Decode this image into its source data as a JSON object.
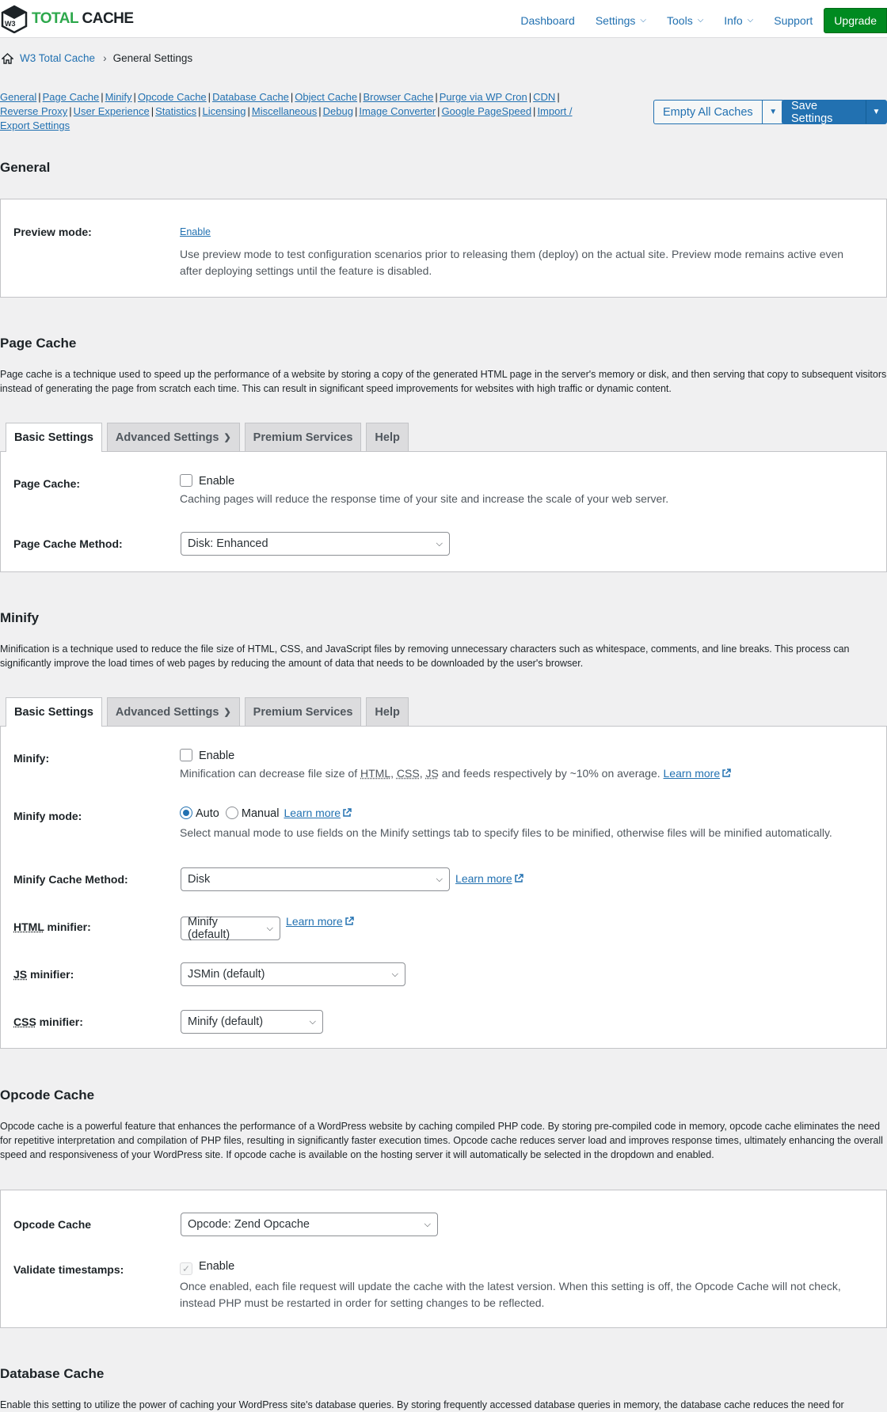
{
  "brand": {
    "logo_badge": "W3",
    "logo_part1": "TOTAL",
    "logo_part2": "CACHE"
  },
  "topnav": [
    {
      "label": "Dashboard",
      "dropdown": false
    },
    {
      "label": "Settings",
      "dropdown": true
    },
    {
      "label": "Tools",
      "dropdown": true
    },
    {
      "label": "Info",
      "dropdown": true
    },
    {
      "label": "Support",
      "dropdown": false
    }
  ],
  "upgrade_label": "Upgrade",
  "breadcrumb": {
    "root": "W3 Total Cache",
    "current": "General Settings"
  },
  "section_links": [
    "General",
    "Page Cache",
    "Minify",
    "Opcode Cache",
    "Database Cache",
    "Object Cache",
    "Browser Cache",
    "Purge via WP Cron",
    "CDN",
    "Reverse Proxy",
    "User Experience",
    "Statistics",
    "Licensing",
    "Miscellaneous",
    "Debug",
    "Image Converter",
    "Google PageSpeed",
    "Import / Export Settings"
  ],
  "actions": {
    "empty_caches": "Empty All Caches",
    "save_settings": "Save Settings"
  },
  "general": {
    "title": "General",
    "preview_label": "Preview mode:",
    "preview_link": "Enable",
    "preview_help": "Use preview mode to test configuration scenarios prior to releasing them (deploy) on the actual site. Preview mode remains active even after deploying settings until the feature is disabled."
  },
  "tabs": [
    "Basic Settings",
    "Advanced Settings",
    "Premium Services",
    "Help"
  ],
  "page_cache": {
    "title": "Page Cache",
    "description": "Page cache is a technique used to speed up the performance of a website by storing a copy of the generated HTML page in the server's memory or disk, and then serving that copy to subsequent visitors instead of generating the page from scratch each time. This can result in significant speed improvements for websites with high traffic or dynamic content.",
    "enable_label": "Page Cache:",
    "enable_text": "Enable",
    "enable_help": "Caching pages will reduce the response time of your site and increase the scale of your web server.",
    "method_label": "Page Cache Method:",
    "method_value": "Disk: Enhanced"
  },
  "minify": {
    "title": "Minify",
    "description": "Minification is a technique used to reduce the file size of HTML, CSS, and JavaScript files by removing unnecessary characters such as whitespace, comments, and line breaks. This process can significantly improve the load times of web pages by reducing the amount of data that needs to be downloaded by the user's browser.",
    "enable_label": "Minify:",
    "enable_text": "Enable",
    "enable_help_1": "Minification can decrease file size of ",
    "abbr_html": "HTML",
    "abbr_css": "CSS",
    "abbr_js": "JS",
    "enable_help_2": " and feeds respectively by ~10% on average.",
    "learn_more": "Learn more",
    "mode_label": "Minify mode:",
    "mode_auto": "Auto",
    "mode_manual": "Manual",
    "mode_help": "Select manual mode to use fields on the Minify settings tab to specify files to be minified, otherwise files will be minified automatically.",
    "cache_method_label": "Minify Cache Method:",
    "cache_method_value": "Disk",
    "html_minifier_label": " minifier:",
    "html_minifier_value": "Minify (default)",
    "js_minifier_label": " minifier:",
    "js_minifier_value": "JSMin (default)",
    "css_minifier_label": " minifier:",
    "css_minifier_value": "Minify (default)"
  },
  "opcode": {
    "title": "Opcode Cache",
    "description": "Opcode cache is a powerful feature that enhances the performance of a WordPress website by caching compiled PHP code. By storing pre-compiled code in memory, opcode cache eliminates the need for repetitive interpretation and compilation of PHP files, resulting in significantly faster execution times. Opcode cache reduces server load and improves response times, ultimately enhancing the overall speed and responsiveness of your WordPress site. If opcode cache is available on the hosting server it will automatically be selected in the dropdown and enabled.",
    "cache_label": "Opcode Cache",
    "cache_value": "Opcode: Zend Opcache",
    "validate_label": "Validate timestamps:",
    "validate_text": "Enable",
    "validate_help": "Once enabled, each file request will update the cache with the latest version. When this setting is off, the Opcode Cache will not check, instead PHP must be restarted in order for setting changes to be reflected."
  },
  "database": {
    "title": "Database Cache",
    "description": "Enable this setting to utilize the power of caching your WordPress site's database queries. By storing frequently accessed database queries in memory, the database cache reduces the need for"
  }
}
